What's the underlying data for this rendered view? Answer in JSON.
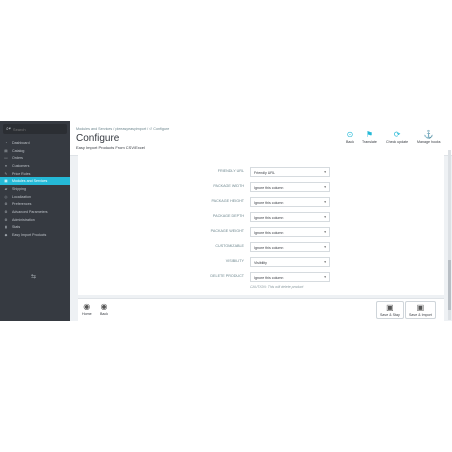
{
  "search": {
    "placeholder": "Search"
  },
  "sidebar": {
    "items": [
      {
        "icon": "dashboard-icon",
        "glyph": "◔",
        "label": "Dashboard"
      },
      {
        "icon": "catalog-icon",
        "glyph": "▤",
        "label": "Catalog"
      },
      {
        "icon": "orders-icon",
        "glyph": "▭",
        "label": "Orders"
      },
      {
        "icon": "customers-icon",
        "glyph": "●",
        "label": "Customers"
      },
      {
        "icon": "price-rules-icon",
        "glyph": "✎",
        "label": "Price Rules"
      },
      {
        "icon": "modules-icon",
        "glyph": "▦",
        "label": "Modules and Services",
        "active": true
      },
      {
        "icon": "shipping-icon",
        "glyph": "▰",
        "label": "Shipping"
      },
      {
        "icon": "localization-icon",
        "glyph": "◎",
        "label": "Localization"
      },
      {
        "icon": "preferences-icon",
        "glyph": "⚙",
        "label": "Preferences"
      },
      {
        "icon": "advanced-parameters-icon",
        "glyph": "⚙",
        "label": "Advanced Parameters"
      },
      {
        "icon": "administration-icon",
        "glyph": "⚙",
        "label": "Administration"
      },
      {
        "icon": "stats-icon",
        "glyph": "▮",
        "label": "Stats"
      },
      {
        "icon": "easy-import-icon",
        "glyph": "◆",
        "label": "Easy Import Products"
      }
    ]
  },
  "header": {
    "breadcrumb": "Modules and Services  /  pleeasyeasyimport  /  ↺ Configure",
    "title": "Configure",
    "subtitle": "Easy Import Products From CSV/Excel"
  },
  "toolbar": {
    "back": "Back",
    "translate": "Translate",
    "check_update": "Check update",
    "manage_hooks": "Manage hooks"
  },
  "form": {
    "rows": [
      {
        "label": "FRIENDLY URL",
        "value": "Friendly URL"
      },
      {
        "label": "PACKAGE WIDTH",
        "value": "Ignore this column"
      },
      {
        "label": "PACKAGE HEIGHT",
        "value": "Ignore this column"
      },
      {
        "label": "PACKAGE DEPTH",
        "value": "Ignore this column"
      },
      {
        "label": "PACKAGE WEIGHT",
        "value": "Ignore this column"
      },
      {
        "label": "CUSTOMIZABLE",
        "value": "Ignore this column"
      },
      {
        "label": "VISIBILITY",
        "value": "Visibility"
      },
      {
        "label": "DELETE PRODUCT",
        "value": "Ignore this column"
      }
    ],
    "caution": "CAUTION: This will delete product"
  },
  "footer": {
    "home": "Home",
    "back": "Back",
    "save_stay": "Save & Stay",
    "save_import": "Save & Import"
  },
  "colors": {
    "accent": "#25b9d7",
    "sidebar": "#363a41"
  }
}
